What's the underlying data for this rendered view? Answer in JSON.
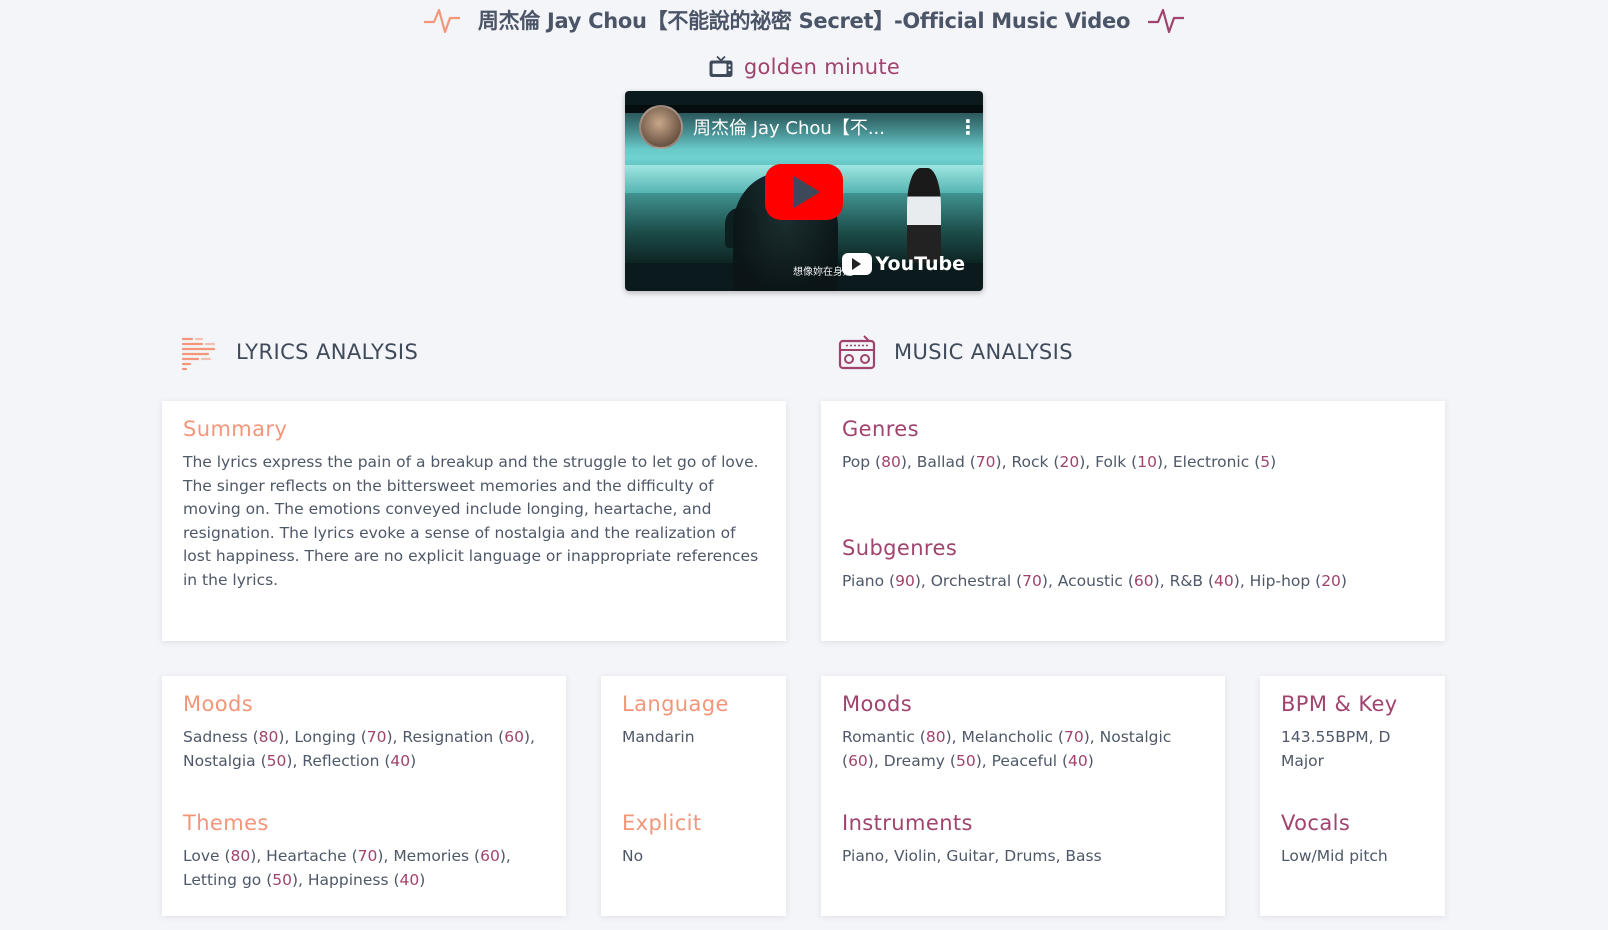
{
  "header": {
    "song_title": "周杰倫 Jay Chou【不能說的祕密 Secret】-Official Music Video",
    "mood_tag": "golden minute"
  },
  "video": {
    "title": "周杰倫 Jay Chou【不...",
    "subtitle": "想像妳在身邊",
    "brand": "YouTube"
  },
  "sections": {
    "lyrics": "LYRICS ANALYSIS",
    "music": "MUSIC ANALYSIS"
  },
  "lyrics": {
    "summary_title": "Summary",
    "summary_text": "The lyrics express the pain of a breakup and the struggle to let go of love. The singer reflects on the bittersweet memories and the difficulty of moving on. The emotions conveyed include longing, heartache, and resignation. The lyrics evoke a sense of nostalgia and the realization of lost happiness. There are no explicit language or inappropriate references in the lyrics.",
    "moods_title": "Moods",
    "moods": [
      {
        "name": "Sadness",
        "score": 80
      },
      {
        "name": "Longing",
        "score": 70
      },
      {
        "name": "Resignation",
        "score": 60
      },
      {
        "name": "Nostalgia",
        "score": 50
      },
      {
        "name": "Reflection",
        "score": 40
      }
    ],
    "themes_title": "Themes",
    "themes": [
      {
        "name": "Love",
        "score": 80
      },
      {
        "name": "Heartache",
        "score": 70
      },
      {
        "name": "Memories",
        "score": 60
      },
      {
        "name": "Letting go",
        "score": 50
      },
      {
        "name": "Happiness",
        "score": 40
      }
    ],
    "language_title": "Language",
    "language": "Mandarin",
    "explicit_title": "Explicit",
    "explicit": "No"
  },
  "music": {
    "genres_title": "Genres",
    "genres": [
      {
        "name": "Pop",
        "score": 80
      },
      {
        "name": "Ballad",
        "score": 70
      },
      {
        "name": "Rock",
        "score": 20
      },
      {
        "name": "Folk",
        "score": 10
      },
      {
        "name": "Electronic",
        "score": 5
      }
    ],
    "subgenres_title": "Subgenres",
    "subgenres": [
      {
        "name": "Piano",
        "score": 90
      },
      {
        "name": "Orchestral",
        "score": 70
      },
      {
        "name": "Acoustic",
        "score": 60
      },
      {
        "name": "R&B",
        "score": 40
      },
      {
        "name": "Hip-hop",
        "score": 20
      }
    ],
    "moods_title": "Moods",
    "moods": [
      {
        "name": "Romantic",
        "score": 80
      },
      {
        "name": "Melancholic",
        "score": 70
      },
      {
        "name": "Nostalgic",
        "score": 60
      },
      {
        "name": "Dreamy",
        "score": 50
      },
      {
        "name": "Peaceful",
        "score": 40
      }
    ],
    "instruments_title": "Instruments",
    "instruments": "Piano, Violin, Guitar, Drums, Bass",
    "bpm_title": "BPM & Key",
    "bpm_key": "143.55BPM, D Major",
    "vocals_title": "Vocals",
    "vocals": "Low/Mid pitch"
  },
  "colors": {
    "accent_orange": "#f3967a",
    "accent_plum": "#a0436e",
    "background": "#f4f5f9"
  },
  "icons": {
    "title_left": "pulse-icon",
    "title_right": "pulse-icon",
    "mood": "tv-icon",
    "lyrics": "lines-icon",
    "music": "radio-icon"
  }
}
